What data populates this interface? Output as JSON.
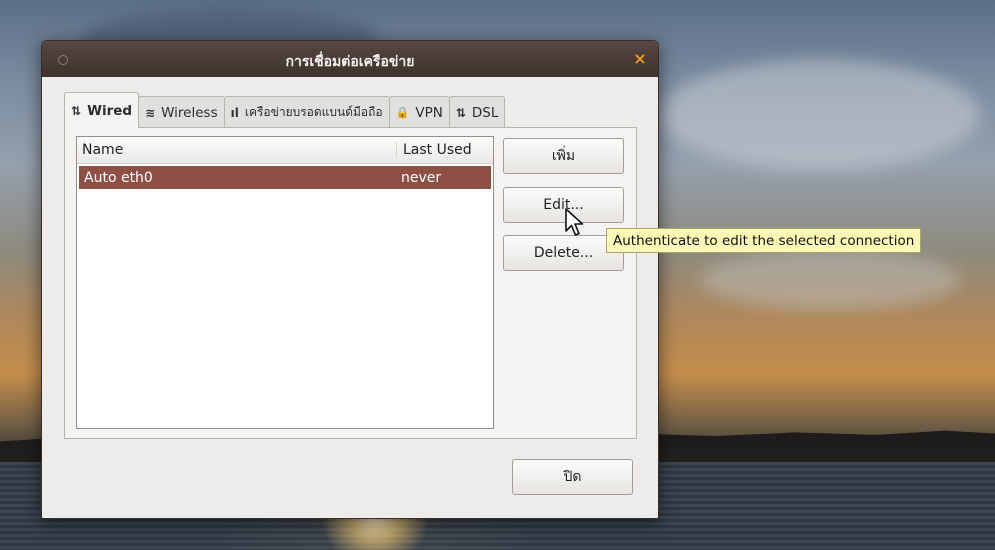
{
  "window": {
    "title": "การเชื่อมต่อเครือข่าย",
    "close_glyph": "×"
  },
  "tabs": [
    {
      "icon": "⇅",
      "icon_name": "wired-network-icon",
      "label": "Wired",
      "active": true
    },
    {
      "icon": "≋",
      "icon_name": "wireless-icon",
      "label": "Wireless",
      "active": false
    },
    {
      "icon": "ıl",
      "icon_name": "mobile-signal-icon",
      "label": "เครือข่ายบรอดแบนด์มือถือ",
      "active": false
    },
    {
      "icon": "🔒",
      "icon_name": "vpn-lock-icon",
      "label": "VPN",
      "active": false
    },
    {
      "icon": "⇅",
      "icon_name": "dsl-network-icon",
      "label": "DSL",
      "active": false
    }
  ],
  "list": {
    "columns": [
      "Name",
      "Last Used"
    ],
    "rows": [
      {
        "name": "Auto eth0",
        "last_used": "never",
        "selected": true
      }
    ]
  },
  "buttons": {
    "add": "เพิ่ม",
    "edit": "Edit...",
    "delete": "Delete...",
    "close": "ปิด"
  },
  "tooltip": "Authenticate to edit the selected connection",
  "colors": {
    "selection": "#8e5044",
    "titlebar": "#3d322d",
    "tooltip_bg": "#fbf7b4"
  }
}
